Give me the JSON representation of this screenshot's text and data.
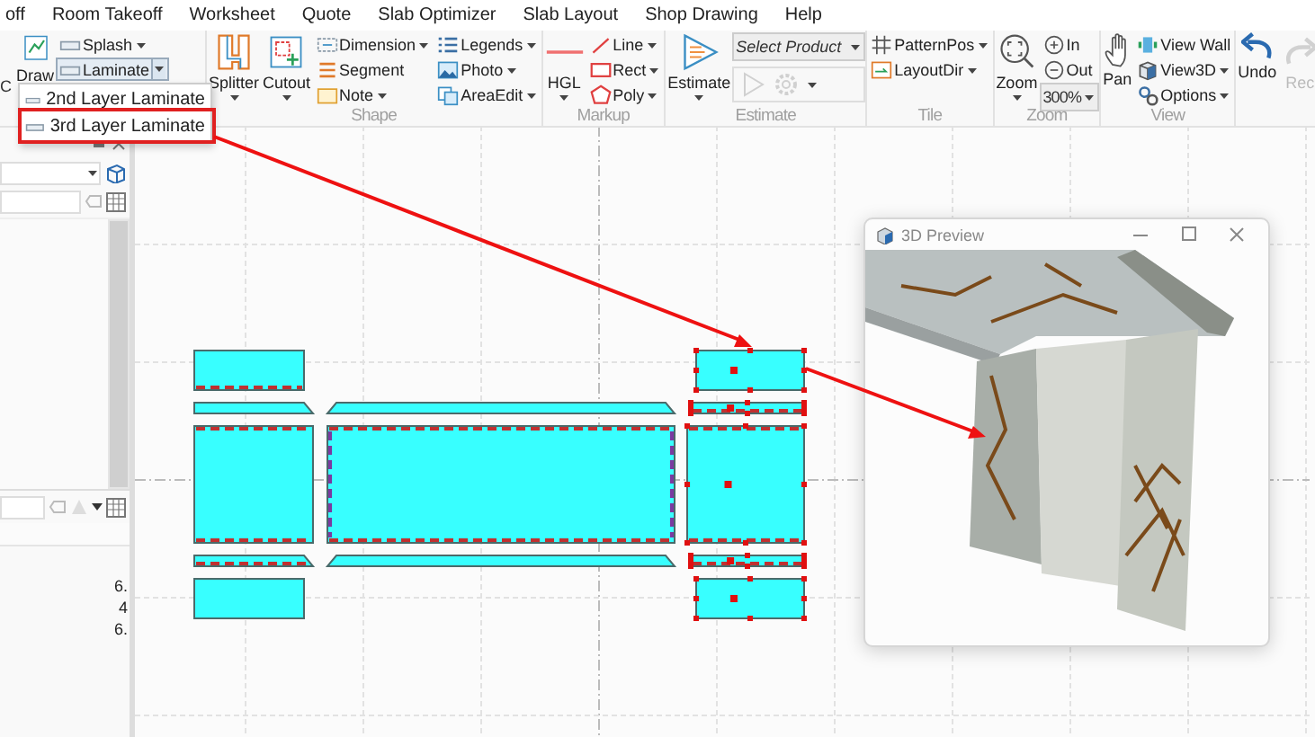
{
  "menu_tabs": [
    "off",
    "Room Takeoff",
    "Worksheet",
    "Quote",
    "Slab Optimizer",
    "Slab Layout",
    "Shop Drawing",
    "Help"
  ],
  "ribbon": {
    "partial_label": "C",
    "groups": [
      {
        "controls": [
          {
            "kind": "large",
            "label": "Draw",
            "disabled": false
          },
          {
            "kind": "stack",
            "items": [
              {
                "kind": "button",
                "label": "Splash",
                "caret": true,
                "expanded": false
              },
              {
                "kind": "button",
                "label": "Laminate",
                "caret": true,
                "expanded": true
              }
            ]
          }
        ]
      },
      {
        "label": "Shape",
        "controls": [
          {
            "kind": "large",
            "label": "Splitter",
            "caret": true,
            "disabled": false
          },
          {
            "kind": "large",
            "label": "Cutout",
            "caret": true,
            "disabled": false
          },
          {
            "kind": "stack",
            "items": [
              {
                "kind": "button",
                "label": "Dimension",
                "caret": true,
                "expanded": false
              },
              {
                "kind": "button",
                "label": "Segment",
                "caret": false,
                "expanded": false
              },
              {
                "kind": "button",
                "label": "Note",
                "caret": true,
                "expanded": false
              }
            ]
          },
          {
            "kind": "stack",
            "items": [
              {
                "kind": "button",
                "label": "Legends",
                "caret": true,
                "expanded": false
              },
              {
                "kind": "button",
                "label": "Photo",
                "caret": true,
                "expanded": false
              },
              {
                "kind": "button",
                "label": "AreaEdit",
                "caret": true,
                "expanded": false
              }
            ]
          }
        ]
      },
      {
        "label": "Markup",
        "controls": [
          {
            "kind": "large",
            "label": "HGL",
            "caret": true,
            "disabled": false
          },
          {
            "kind": "stack",
            "items": [
              {
                "kind": "button",
                "label": "Line",
                "caret": true,
                "expanded": false
              },
              {
                "kind": "button",
                "label": "Rect",
                "caret": true,
                "expanded": false
              },
              {
                "kind": "button",
                "label": "Poly",
                "caret": true,
                "expanded": false
              }
            ]
          }
        ]
      },
      {
        "label": "Estimate",
        "controls": [
          {
            "kind": "large",
            "label": "Estimate",
            "caret": true,
            "disabled": false
          },
          {
            "kind": "stack",
            "items": [
              {
                "kind": "combo",
                "placeholder": "Select Product"
              },
              {
                "kind": "icons",
                "caret": true,
                "buttons": [
                  {
                    "disabled": true
                  },
                  {
                    "disabled": true
                  }
                ]
              }
            ]
          }
        ]
      },
      {
        "label": "Tile",
        "controls": [
          {
            "kind": "stack",
            "items": [
              {
                "kind": "button",
                "label": "PatternPos",
                "caret": true,
                "expanded": false
              },
              {
                "kind": "button",
                "label": "LayoutDir",
                "caret": true,
                "expanded": false
              }
            ]
          }
        ]
      },
      {
        "label": "Zoom",
        "controls": [
          {
            "kind": "large",
            "label": "Zoom",
            "caret": true,
            "disabled": false
          },
          {
            "kind": "stack",
            "items": [
              {
                "kind": "button",
                "label": "In",
                "caret": false,
                "expanded": false
              },
              {
                "kind": "button",
                "label": "Out",
                "caret": false,
                "expanded": false
              },
              {
                "kind": "combo",
                "value": "300%"
              }
            ]
          }
        ]
      },
      {
        "label": "View",
        "controls": [
          {
            "kind": "large",
            "label": "Pan",
            "caret": false,
            "disabled": false
          },
          {
            "kind": "stack",
            "items": [
              {
                "kind": "button",
                "label": "View Wall",
                "caret": false,
                "expanded": false
              },
              {
                "kind": "button",
                "label": "View3D",
                "caret": true,
                "expanded": false
              },
              {
                "kind": "button",
                "label": "Options",
                "caret": true,
                "expanded": false
              }
            ]
          }
        ]
      },
      {
        "controls": [
          {
            "kind": "large",
            "label": "Undo",
            "caret": false,
            "disabled": false
          },
          {
            "kind": "large",
            "label": "Rec",
            "caret": false,
            "disabled": true
          }
        ]
      }
    ]
  },
  "laminate_menu": {
    "items": [
      {
        "label": "2nd Layer Laminate"
      },
      {
        "label": "3rd Layer Laminate"
      }
    ]
  },
  "side_panel": {
    "values": [
      "6.",
      "4",
      "6."
    ]
  },
  "canvas": {
    "pieces": [
      {
        "kind": "rect",
        "selected": false
      },
      {
        "kind": "strip",
        "selected": false
      },
      {
        "kind": "rect",
        "selected": false
      },
      {
        "kind": "strip",
        "selected": false
      },
      {
        "kind": "rect",
        "selected": false
      },
      {
        "kind": "strip",
        "selected": false
      },
      {
        "kind": "rect",
        "selected": false
      },
      {
        "kind": "strip",
        "selected": false
      },
      {
        "kind": "rect",
        "selected": true
      },
      {
        "kind": "strip",
        "selected": true
      },
      {
        "kind": "rect",
        "selected": true
      },
      {
        "kind": "strip",
        "selected": true
      },
      {
        "kind": "rect",
        "selected": true
      }
    ]
  },
  "preview_window": {
    "title": "3D Preview"
  }
}
